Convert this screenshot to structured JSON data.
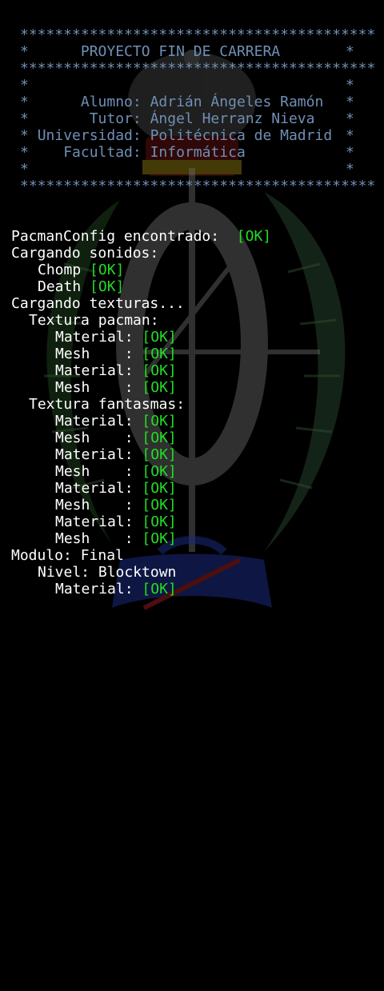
{
  "header": {
    "border": "*****************************************",
    "star": "*",
    "title": "PROYECTO FIN DE CARRERA",
    "rows": [
      {
        "label": "Alumno:",
        "value": "Adrián Ángeles Ramón"
      },
      {
        "label": "Tutor:",
        "value": "Ángel Herranz Nieva"
      },
      {
        "label": "Universidad:",
        "value": "Politécnica de Madrid"
      },
      {
        "label": "Facultad:",
        "value": "Informática"
      }
    ]
  },
  "log": {
    "config": {
      "text": "PacmanConfig encontrado:",
      "status": "[OK]"
    },
    "sounds": {
      "title": "Cargando sonidos:",
      "items": [
        {
          "name": "Chomp",
          "status": "[OK]"
        },
        {
          "name": "Death",
          "status": "[OK]"
        }
      ]
    },
    "textures": {
      "title": "Cargando texturas...",
      "pacman": {
        "title": "Textura pacman:",
        "items": [
          {
            "label": "Material:",
            "status": "[OK]"
          },
          {
            "label": "Mesh    :",
            "status": "[OK]"
          },
          {
            "label": "Material:",
            "status": "[OK]"
          },
          {
            "label": "Mesh    :",
            "status": "[OK]"
          }
        ]
      },
      "ghosts": {
        "title": "Textura fantasmas:",
        "items": [
          {
            "label": "Material:",
            "status": "[OK]"
          },
          {
            "label": "Mesh    :",
            "status": "[OK]"
          },
          {
            "label": "Material:",
            "status": "[OK]"
          },
          {
            "label": "Mesh    :",
            "status": "[OK]"
          },
          {
            "label": "Material:",
            "status": "[OK]"
          },
          {
            "label": "Mesh    :",
            "status": "[OK]"
          },
          {
            "label": "Material:",
            "status": "[OK]"
          },
          {
            "label": "Mesh    :",
            "status": "[OK]"
          }
        ]
      }
    },
    "module": {
      "text": "Modulo: Final"
    },
    "level": {
      "text": "Nivel: Blocktown"
    },
    "level_material": {
      "label": "Material:",
      "status": "[OK]"
    }
  },
  "colors": {
    "header": "#6f8fb5",
    "text": "#ffffff",
    "ok": "#22dd22",
    "background": "#000000"
  },
  "icons": {
    "background": "university-emblem-icon"
  }
}
